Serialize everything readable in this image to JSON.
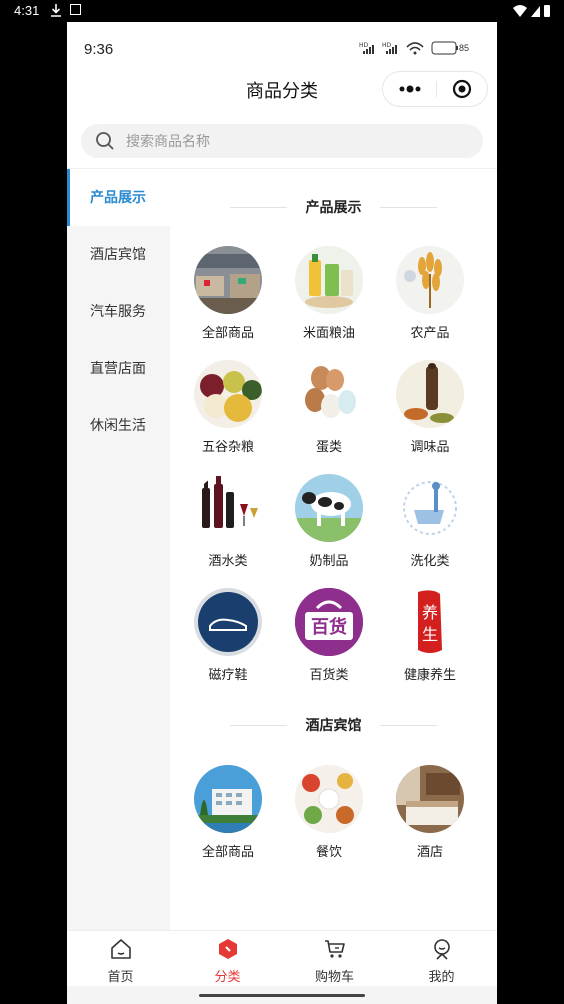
{
  "android_status": {
    "time": "4:31"
  },
  "mini_status": {
    "time": "9:36",
    "battery": "85"
  },
  "header": {
    "title": "商品分类"
  },
  "search": {
    "placeholder": "搜索商品名称"
  },
  "sidebar": {
    "items": [
      {
        "label": "产品展示",
        "active": true
      },
      {
        "label": "酒店宾馆",
        "active": false
      },
      {
        "label": "汽车服务",
        "active": false
      },
      {
        "label": "直营店面",
        "active": false
      },
      {
        "label": "休闲生活",
        "active": false
      }
    ]
  },
  "sections": [
    {
      "title": "产品展示",
      "items": [
        {
          "label": "全部商品",
          "icon": "supermarket-image"
        },
        {
          "label": "米面粮油",
          "icon": "grain-oil-image"
        },
        {
          "label": "农产品",
          "icon": "wheat-image"
        },
        {
          "label": "五谷杂粮",
          "icon": "beans-image"
        },
        {
          "label": "蛋类",
          "icon": "eggs-image"
        },
        {
          "label": "调味品",
          "icon": "spices-image"
        },
        {
          "label": "酒水类",
          "icon": "wine-image"
        },
        {
          "label": "奶制品",
          "icon": "cow-image"
        },
        {
          "label": "洗化类",
          "icon": "bath-image"
        },
        {
          "label": "磁疗鞋",
          "icon": "shoe-image"
        },
        {
          "label": "百货类",
          "icon": "bag-image"
        },
        {
          "label": "健康养生",
          "icon": "health-image"
        }
      ]
    },
    {
      "title": "酒店宾馆",
      "items": [
        {
          "label": "全部商品",
          "icon": "hotel-building-image"
        },
        {
          "label": "餐饮",
          "icon": "food-image"
        },
        {
          "label": "酒店",
          "icon": "hotel-room-image"
        }
      ]
    }
  ],
  "tabbar": {
    "items": [
      {
        "label": "首页",
        "icon": "home-icon",
        "active": false
      },
      {
        "label": "分类",
        "icon": "category-icon",
        "active": true
      },
      {
        "label": "购物车",
        "icon": "cart-icon",
        "active": false
      },
      {
        "label": "我的",
        "icon": "user-icon",
        "active": false
      }
    ]
  },
  "colors": {
    "accent": "#2a8bd0",
    "tab_active": "#e53935"
  }
}
